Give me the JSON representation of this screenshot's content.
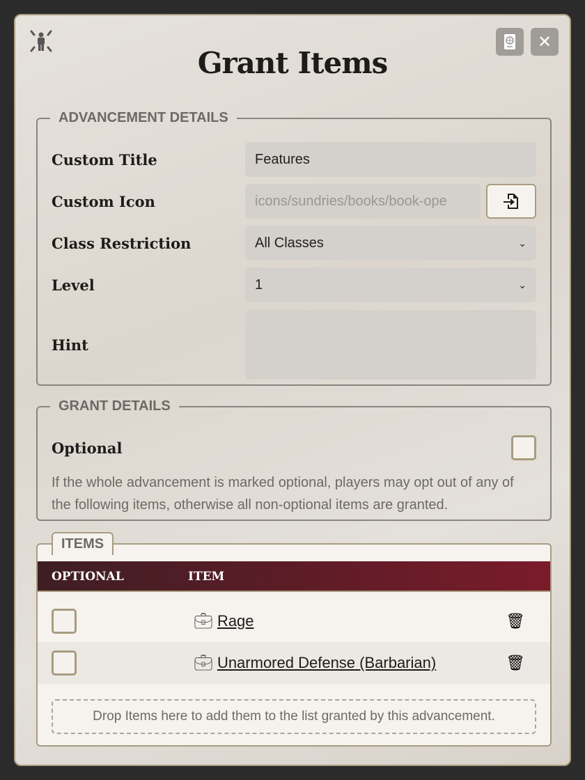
{
  "window": {
    "title": "Grant Items",
    "close_icon": "close-icon",
    "sheet_icon": "passport-globe-icon",
    "system_icon": "person-radiating-icon"
  },
  "advancement": {
    "legend": "ADVANCEMENT DETAILS",
    "custom_title": {
      "label": "Custom Title",
      "value": "Features"
    },
    "custom_icon": {
      "label": "Custom Icon",
      "placeholder": "icons/sundries/books/book-ope"
    },
    "class_restriction": {
      "label": "Class Restriction",
      "value": "All Classes"
    },
    "level": {
      "label": "Level",
      "value": "1"
    },
    "hint": {
      "label": "Hint",
      "value": ""
    }
  },
  "grant": {
    "legend": "GRANT DETAILS",
    "optional_label": "Optional",
    "optional_checked": false,
    "hint": "If the whole advancement is marked optional, players may opt out of any of the following items, otherwise all non-optional items are granted."
  },
  "items": {
    "tab": "ITEMS",
    "col_optional": "OPTIONAL",
    "col_item": "ITEM",
    "rows": [
      {
        "name": "Rage",
        "optional": false
      },
      {
        "name": "Unarmored Defense (Barbarian)",
        "optional": false
      }
    ],
    "drop_hint": "Drop Items here to add them to the list granted by this advancement."
  },
  "colors": {
    "header_start": "#3e1e23",
    "header_end": "#7a1b2a",
    "border": "#a89c80"
  }
}
